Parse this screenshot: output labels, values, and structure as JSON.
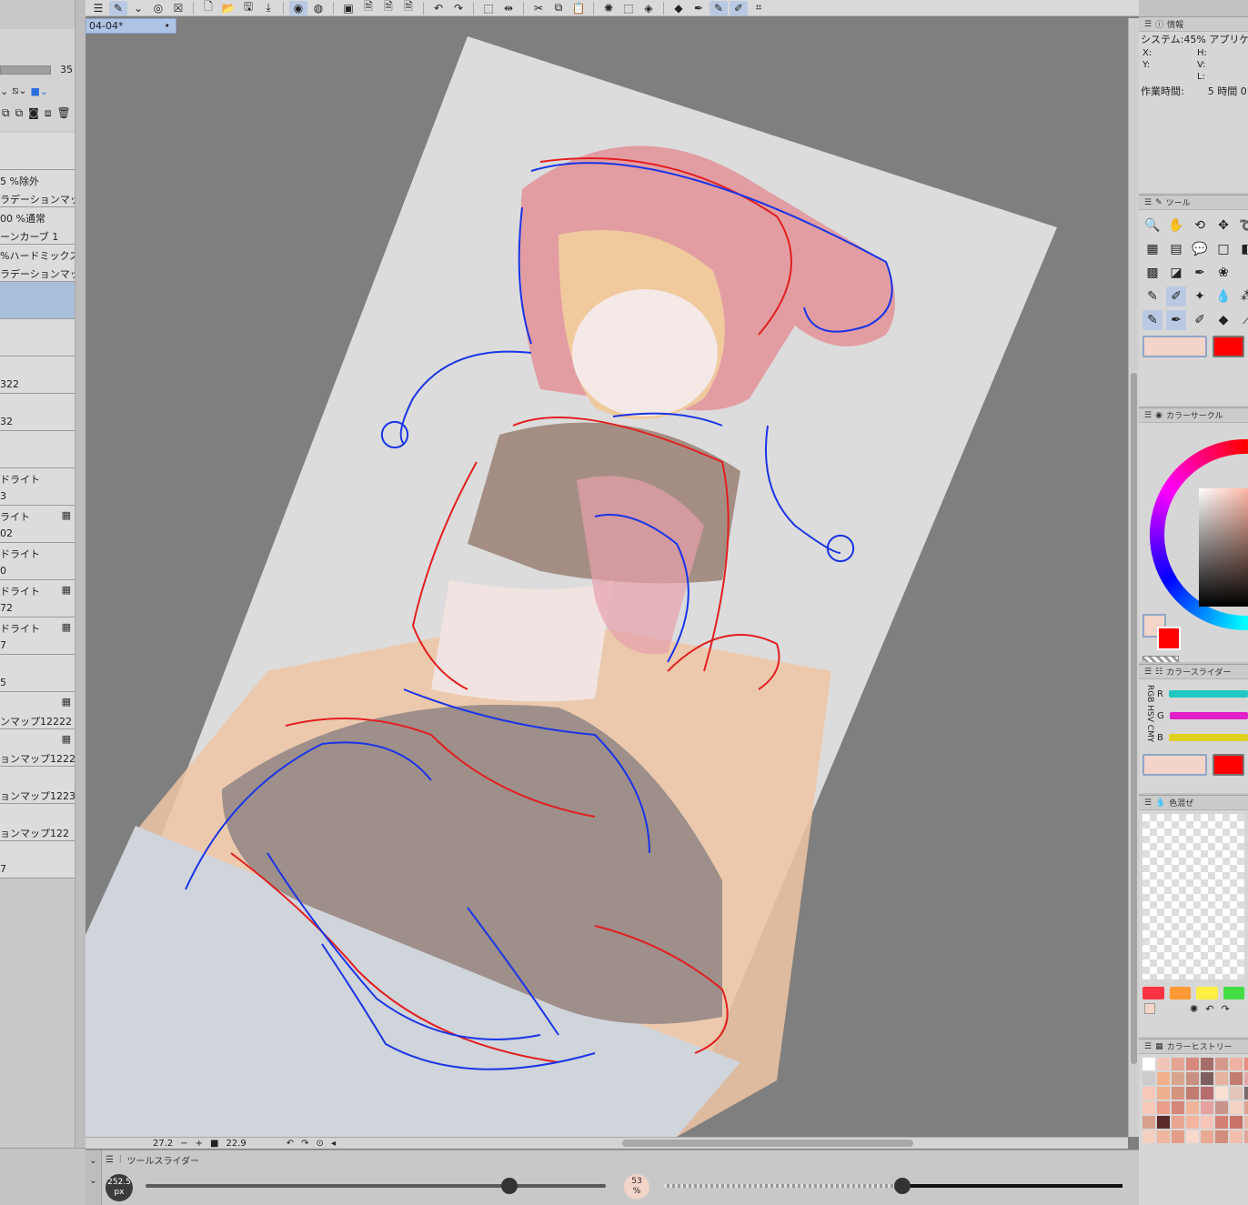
{
  "document": {
    "tab_name": "04-04*",
    "modified_dot": "•"
  },
  "layer_panel": {
    "opacity_value": "35",
    "layers": [
      {
        "line1": "",
        "line2": "",
        "badge": "",
        "selected": false
      },
      {
        "line1": "5 %除外",
        "line2": "ラデーションマップ",
        "badge": "",
        "selected": false
      },
      {
        "line1": "00 %通常",
        "line2": "ーンカーブ 1",
        "badge": "",
        "selected": false
      },
      {
        "line1": "%ハードミックス",
        "line2": "ラデーションマップ",
        "badge": "",
        "selected": false
      },
      {
        "line1": "",
        "line2": "",
        "badge": "",
        "selected": true
      },
      {
        "line1": "",
        "line2": "",
        "badge": "",
        "selected": false
      },
      {
        "line1": "",
        "line2": "322",
        "badge": "",
        "selected": false
      },
      {
        "line1": "",
        "line2": "32",
        "badge": "",
        "selected": false
      },
      {
        "line1": "",
        "line2": "",
        "badge": "",
        "selected": false
      },
      {
        "line1": "ドライト",
        "line2": "3",
        "badge": "",
        "selected": false
      },
      {
        "line1": "ライト",
        "line2": "02",
        "badge": "▦",
        "selected": false
      },
      {
        "line1": "ドライト",
        "line2": "0",
        "badge": "",
        "selected": false
      },
      {
        "line1": "ドライト",
        "line2": "72",
        "badge": "▦",
        "selected": false
      },
      {
        "line1": "ドライト",
        "line2": "7",
        "badge": "▦",
        "selected": false
      },
      {
        "line1": "",
        "line2": "5",
        "badge": "",
        "selected": false
      },
      {
        "line1": "",
        "line2": "ンマップ12222",
        "badge": "▦",
        "selected": false
      },
      {
        "line1": "",
        "line2": "ョンマップ1222",
        "badge": "▦",
        "selected": false
      },
      {
        "line1": "",
        "line2": "ョンマップ1223",
        "badge": "",
        "selected": false
      },
      {
        "line1": "",
        "line2": "ョンマップ122",
        "badge": "",
        "selected": false
      },
      {
        "line1": "",
        "line2": "7",
        "badge": "",
        "selected": false
      }
    ]
  },
  "status": {
    "value_a": "27.2",
    "value_b": "22.9"
  },
  "tool_slider": {
    "title": "ツールスライダー",
    "brush_size": "252.5",
    "brush_unit": "px",
    "opacity": "53",
    "opacity_unit": "%",
    "size_fraction": 0.79,
    "opacity_fraction": 0.52
  },
  "info_panel": {
    "title": "情報",
    "system_line": "システム:45% アプリケー",
    "x_label": "X:",
    "y_label": "Y:",
    "h_label": "H:",
    "v_label": "V:",
    "l_label": "L:",
    "work_time_label": "作業時間:",
    "work_time_value": "5 時間 0"
  },
  "tool_panel": {
    "title": "ツール"
  },
  "color_circle": {
    "title": "カラーサークル"
  },
  "color_slider": {
    "title": "カラースライダー",
    "r": "R",
    "g": "G",
    "b": "B",
    "tabs": "RGB HSV CMY"
  },
  "color_mix": {
    "title": "色混ぜ"
  },
  "color_history": {
    "title": "カラーヒストリー"
  },
  "colors": {
    "main": "#f3d4c9",
    "sub": "#ff0000",
    "accent_tab": "#aec4e6",
    "palette": [
      "#ff3344",
      "#ff9933",
      "#ffee44",
      "#44dd44"
    ],
    "history": [
      "#ffffff",
      "#f1c4b9",
      "#e6a593",
      "#d78b7c",
      "#a56e6a",
      "#d39a8c",
      "#f0b3a3",
      "#e88f7f",
      "#cccccc",
      "#f4b08a",
      "#d8a58c",
      "#c98f80",
      "#7e5f5d",
      "#e6b3a1",
      "#c37c70",
      "#e5a6a3",
      "#f7c7b8",
      "#edb08d",
      "#d4947e",
      "#c27c70",
      "#b86d6d",
      "#fbe0d4",
      "#e1c5b8",
      "#7c6a6a",
      "#f6c9b8",
      "#ea9d89",
      "#d48778",
      "#f0b598",
      "#e6a2a0",
      "#c9938c",
      "#f4d2c4",
      "#dfa08f",
      "#d8a08a",
      "#5a2a2a",
      "#e8a58f",
      "#f3b4a0",
      "#f7c6b9",
      "#d38074",
      "#c87166",
      "#e9b8a5",
      "#f5d0c0",
      "#efb59e",
      "#e49c88",
      "#f8d7cc",
      "#e9a993",
      "#d28d7b",
      "#f2bfae",
      "#e3a596"
    ]
  }
}
